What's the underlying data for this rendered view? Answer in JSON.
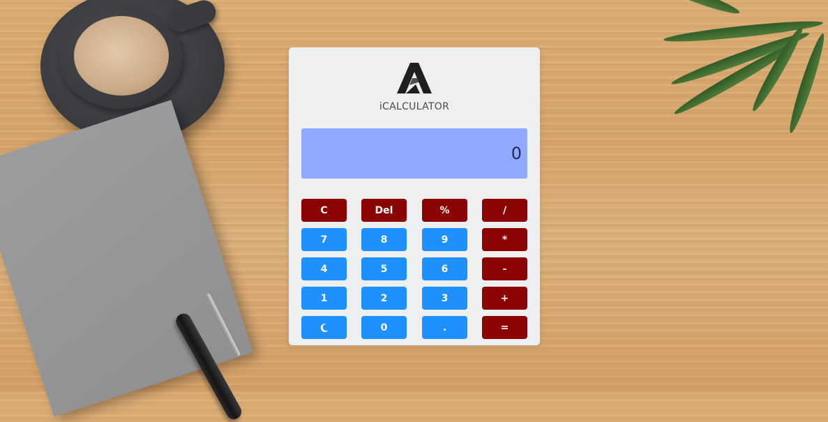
{
  "app": {
    "brand": "iCALCULATOR"
  },
  "display": {
    "value": "0"
  },
  "keys": [
    {
      "label": "C",
      "kind": "red",
      "name": "clear-button"
    },
    {
      "label": "Del",
      "kind": "red",
      "name": "delete-button"
    },
    {
      "label": "%",
      "kind": "red",
      "name": "percent-button"
    },
    {
      "label": "/",
      "kind": "red",
      "name": "divide-button"
    },
    {
      "label": "7",
      "kind": "blue",
      "name": "digit-7-button"
    },
    {
      "label": "8",
      "kind": "blue",
      "name": "digit-8-button"
    },
    {
      "label": "9",
      "kind": "blue",
      "name": "digit-9-button"
    },
    {
      "label": "*",
      "kind": "red",
      "name": "multiply-button"
    },
    {
      "label": "4",
      "kind": "blue",
      "name": "digit-4-button"
    },
    {
      "label": "5",
      "kind": "blue",
      "name": "digit-5-button"
    },
    {
      "label": "6",
      "kind": "blue",
      "name": "digit-6-button"
    },
    {
      "label": "-",
      "kind": "red",
      "name": "subtract-button"
    },
    {
      "label": "1",
      "kind": "blue",
      "name": "digit-1-button"
    },
    {
      "label": "2",
      "kind": "blue",
      "name": "digit-2-button"
    },
    {
      "label": "3",
      "kind": "blue",
      "name": "digit-3-button"
    },
    {
      "label": "+",
      "kind": "red",
      "name": "add-button"
    },
    {
      "label": "",
      "kind": "blue",
      "name": "dark-mode-toggle",
      "icon": "moon-icon"
    },
    {
      "label": "0",
      "kind": "blue",
      "name": "digit-0-button"
    },
    {
      "label": ".",
      "kind": "blue",
      "name": "decimal-button"
    },
    {
      "label": "=",
      "kind": "red",
      "name": "equals-button"
    }
  ],
  "colors": {
    "operator_key": "#8a0404",
    "number_key": "#1e90ff",
    "display_bg": "#90a8fd",
    "panel_bg": "#eeeff1"
  }
}
